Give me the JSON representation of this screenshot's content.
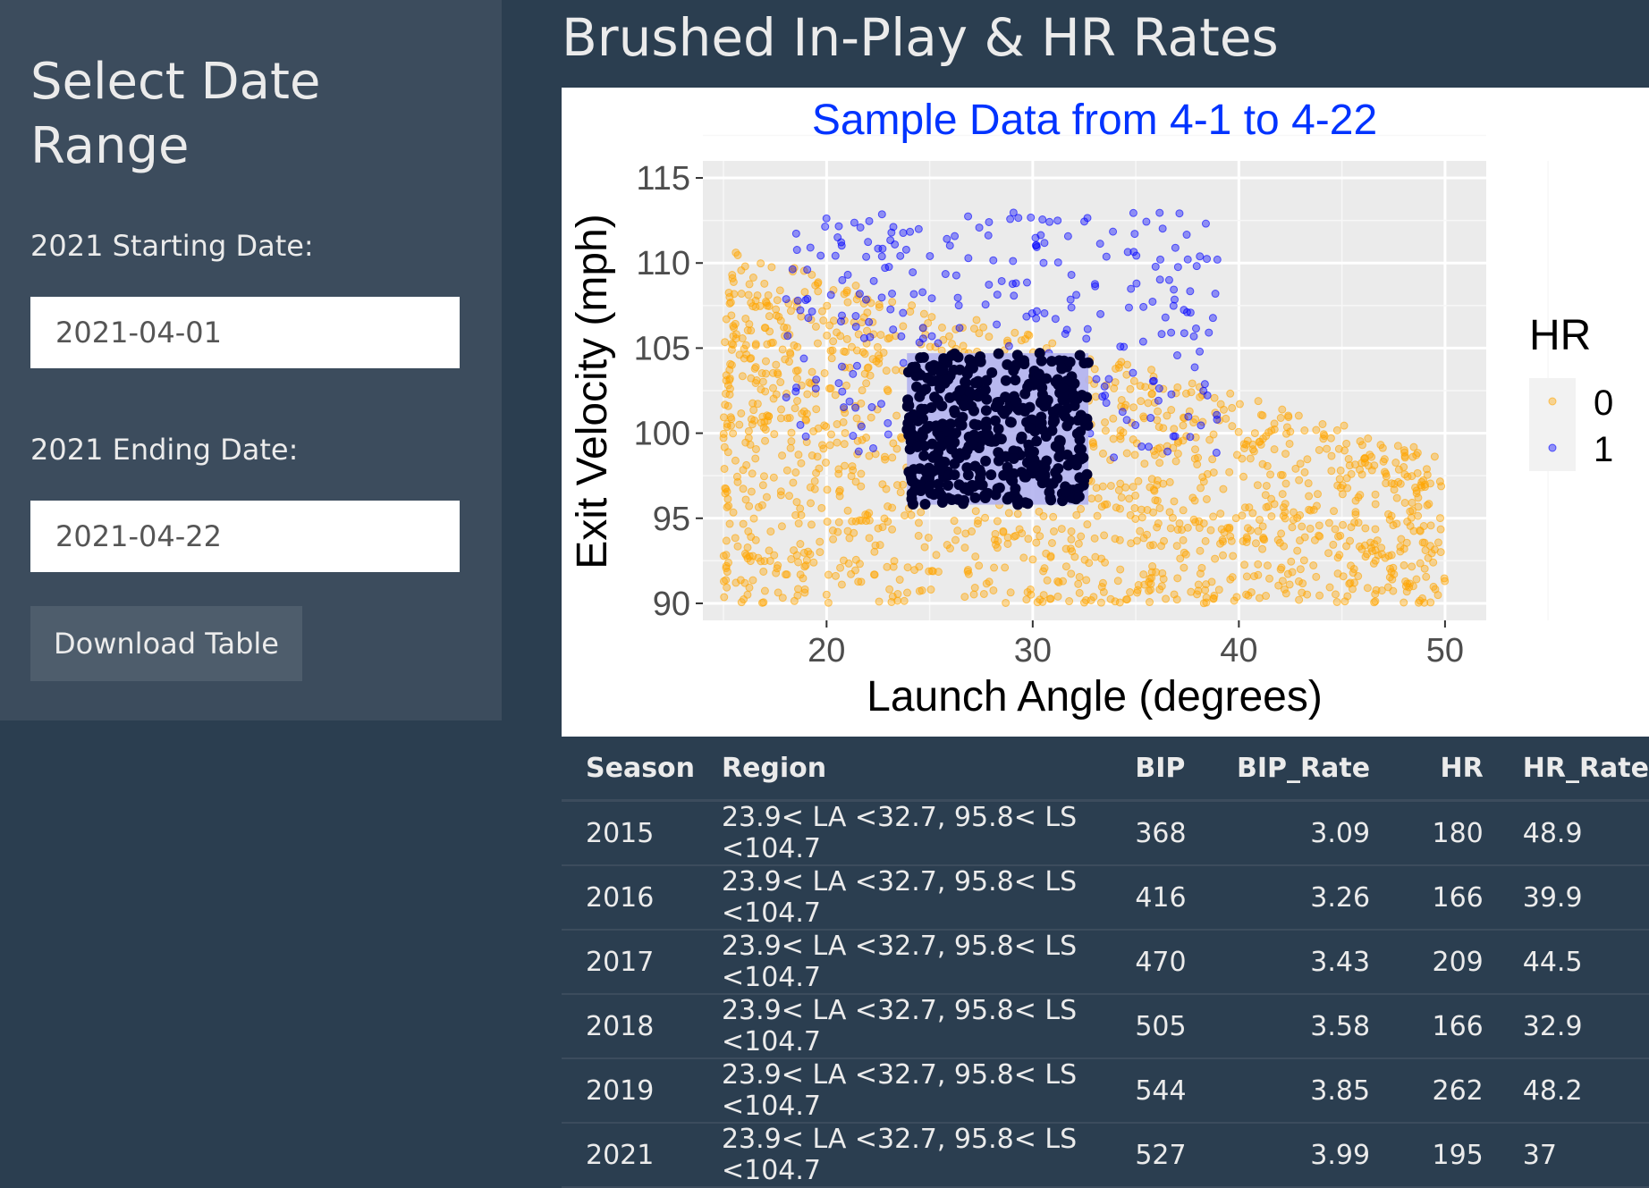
{
  "sidebar": {
    "title": "Select Date Range",
    "start_label": "2021 Starting Date:",
    "start_value": "2021-04-01",
    "end_label": "2021 Ending Date:",
    "end_value": "2021-04-22",
    "download_label": "Download Table"
  },
  "main": {
    "title": "Brushed In-Play & HR Rates"
  },
  "chart_data": {
    "type": "scatter",
    "title": "Sample Data from 4-1 to 4-22",
    "xlabel": "Launch Angle (degrees)",
    "ylabel": "Exit Velocity (mph)",
    "xlim": [
      14,
      52
    ],
    "ylim": [
      89,
      116
    ],
    "x_ticks": [
      20,
      30,
      40,
      50
    ],
    "y_ticks": [
      90,
      95,
      100,
      105,
      110,
      115
    ],
    "grid": true,
    "legend": {
      "title": "HR",
      "placement": "right",
      "entries": [
        {
          "name": "0",
          "color": "#ffa500"
        },
        {
          "name": "1",
          "color": "#0000ff"
        }
      ]
    },
    "brush": {
      "x": [
        23.9,
        32.7
      ],
      "y": [
        95.8,
        104.7
      ],
      "fill": "#b3b3f0",
      "point_color": "#000033"
    },
    "series": [
      {
        "name": "0",
        "color": "#ffa500",
        "description": "non-HR batted balls; dense over LA 15-50, EV 90-110"
      },
      {
        "name": "1",
        "color": "#0000ff",
        "description": "home runs; concentrated LA 20-40, EV 100-114"
      }
    ],
    "colors": {
      "title": "#0033ff",
      "panel": "#ebebeb"
    }
  },
  "table": {
    "headers": [
      "Season",
      "Region",
      "BIP",
      "BIP_Rate",
      "HR",
      "HR_Rate"
    ],
    "rows": [
      [
        "2015",
        "23.9< LA <32.7, 95.8< LS <104.7",
        "368",
        "3.09",
        "180",
        "48.9"
      ],
      [
        "2016",
        "23.9< LA <32.7, 95.8< LS <104.7",
        "416",
        "3.26",
        "166",
        "39.9"
      ],
      [
        "2017",
        "23.9< LA <32.7, 95.8< LS <104.7",
        "470",
        "3.43",
        "209",
        "44.5"
      ],
      [
        "2018",
        "23.9< LA <32.7, 95.8< LS <104.7",
        "505",
        "3.58",
        "166",
        "32.9"
      ],
      [
        "2019",
        "23.9< LA <32.7, 95.8< LS <104.7",
        "544",
        "3.85",
        "262",
        "48.2"
      ],
      [
        "2021",
        "23.9< LA <32.7, 95.8< LS <104.7",
        "527",
        "3.99",
        "195",
        "37"
      ]
    ]
  }
}
